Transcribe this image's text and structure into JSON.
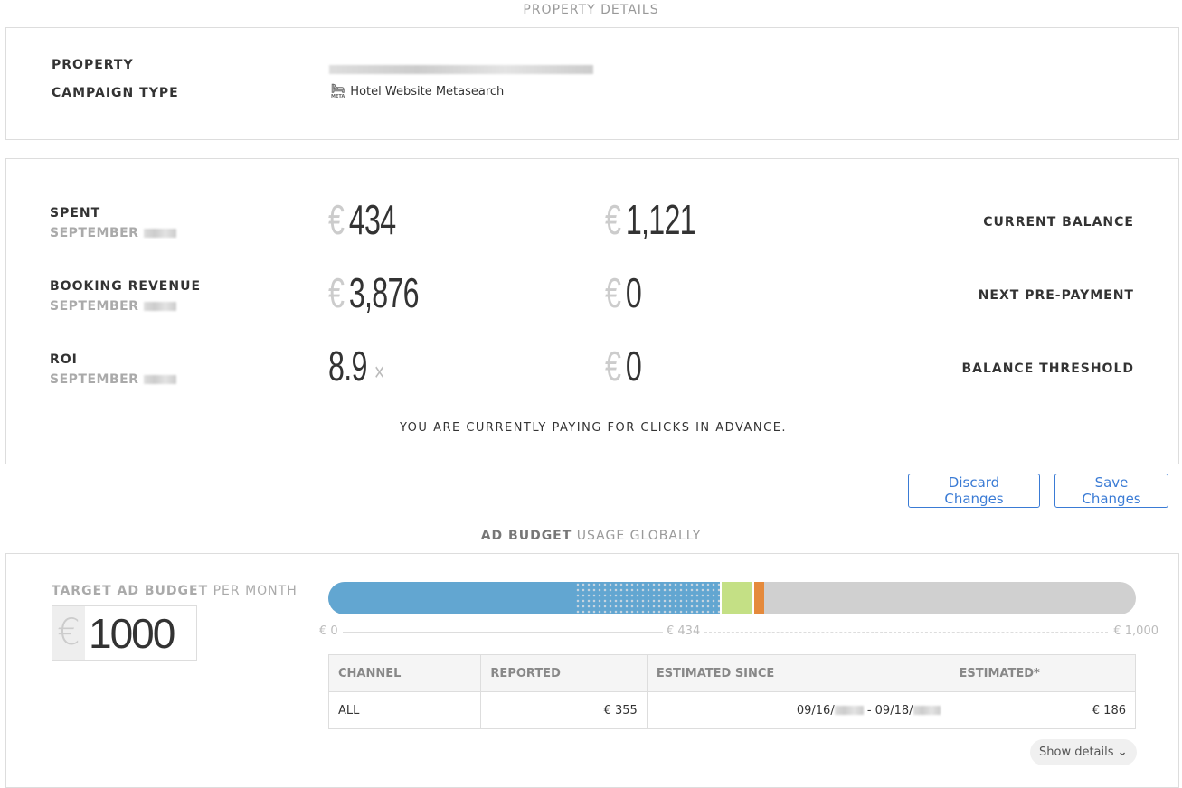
{
  "property_details": {
    "title": "PROPERTY DETAILS",
    "property_label": "PROPERTY",
    "campaign_type_label": "CAMPAIGN TYPE",
    "campaign_type_value": "Hotel Website Metasearch",
    "meta_icon_text": "META"
  },
  "stats": {
    "rows": [
      {
        "label": "SPENT",
        "sub": "SEPTEMBER",
        "value_currency": "€",
        "value": "434",
        "right_currency": "€",
        "right_value": "1,121",
        "right_label": "CURRENT BALANCE"
      },
      {
        "label": "BOOKING REVENUE",
        "sub": "SEPTEMBER",
        "value_currency": "€",
        "value": "3,876",
        "right_currency": "€",
        "right_value": "0",
        "right_label": "NEXT PRE-PAYMENT"
      },
      {
        "label": "ROI",
        "sub": "SEPTEMBER",
        "value": "8.9",
        "value_suffix": "×",
        "right_currency": "€",
        "right_value": "0",
        "right_label": "BALANCE THRESHOLD"
      }
    ],
    "notice": "YOU ARE CURRENTLY PAYING FOR CLICKS IN ADVANCE."
  },
  "actions": {
    "discard": "Discard Changes",
    "save": "Save Changes"
  },
  "ad_budget": {
    "title_bold": "AD BUDGET",
    "title_rest": "USAGE GLOBALLY",
    "target_label": "TARGET AD BUDGET",
    "target_label_rest": "PER MONTH",
    "currency": "€",
    "target_value": "1000",
    "bar_segments_percent": {
      "reported": 30.6,
      "estimated": 17.9,
      "green": 4.0,
      "orange": 1.5
    },
    "colors": {
      "blue": "#62a6d1",
      "green": "#c4e085",
      "orange": "#e58a3c",
      "remaining": "#d0d0d0"
    },
    "axis": {
      "min": "€ 0",
      "mid": "€ 434",
      "max": "€ 1,000"
    },
    "table": {
      "headers": [
        "CHANNEL",
        "REPORTED",
        "ESTIMATED SINCE",
        "ESTIMATED*"
      ],
      "rows": [
        {
          "channel": "ALL",
          "reported": "€ 355",
          "since_a": "09/16/",
          "since_b": " - 09/18/",
          "estimated": "€ 186"
        }
      ]
    },
    "show_details": "Show details"
  }
}
